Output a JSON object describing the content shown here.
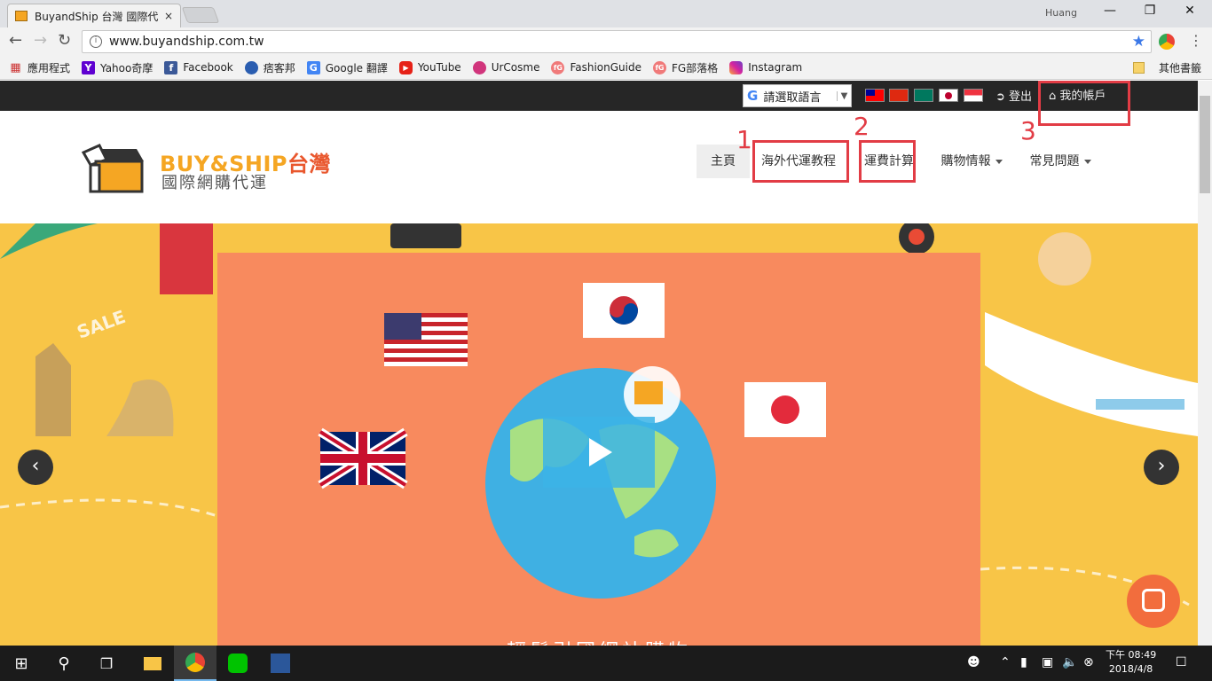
{
  "browser": {
    "tab_title": "BuyandShip 台灣 國際代",
    "tab_close": "×",
    "user": "Huang",
    "url": "www.buyandship.com.tw"
  },
  "bookmarks": {
    "items": [
      {
        "label": "應用程式",
        "icon": "apps-grid-icon"
      },
      {
        "label": "Yahoo奇摩",
        "icon": "yahoo-icon"
      },
      {
        "label": "Facebook",
        "icon": "facebook-icon"
      },
      {
        "label": "痞客邦",
        "icon": "pixnet-icon"
      },
      {
        "label": "Google 翻譯",
        "icon": "google-translate-icon"
      },
      {
        "label": "YouTube",
        "icon": "youtube-icon"
      },
      {
        "label": "UrCosme",
        "icon": "urcosme-icon"
      },
      {
        "label": "FashionGuide",
        "icon": "fashionguide-icon"
      },
      {
        "label": "FG部落格",
        "icon": "fg-blog-icon"
      },
      {
        "label": "Instagram",
        "icon": "instagram-icon"
      }
    ],
    "other": "其他書籤"
  },
  "site": {
    "language_select": "請選取語言",
    "logout": "登出",
    "account": "我的帳戶",
    "brand_main": "BUY&SHIP",
    "brand_region": "台灣",
    "brand_sub": "國際網購代運",
    "nav": [
      {
        "label": "主頁"
      },
      {
        "label": "海外代運教程"
      },
      {
        "label": "運費計算"
      },
      {
        "label": "購物情報"
      },
      {
        "label": "常見問題"
      }
    ],
    "hero_caption": "輕鬆引國網站購物"
  },
  "annotations": {
    "n1": "1",
    "n2": "2",
    "n3": "3"
  },
  "taskbar": {
    "time": "下午 08:49",
    "date": "2018/4/8"
  },
  "colors": {
    "annotation_red": "#e23c45",
    "brand_orange": "#f5a623",
    "hero_bg": "#f8c547",
    "video_bg": "#f88a5e"
  }
}
